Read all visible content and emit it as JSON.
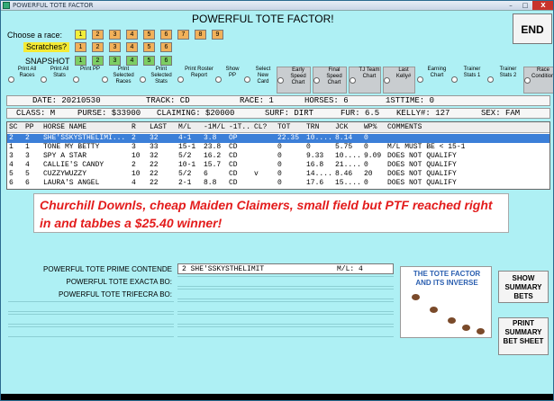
{
  "window": {
    "title": "POWERFUL TOTE FACTOR",
    "minimize": "–",
    "maximize": "□",
    "close": "X"
  },
  "app_title": "POWERFUL TOTE FACTOR!",
  "end_button": "END",
  "choose_race_label": "Choose  a race:",
  "scratches_label": "Scratches?",
  "snapshot_label": "SNAPSHOT",
  "race_buttons": [
    "1",
    "2",
    "3",
    "4",
    "5",
    "6",
    "7",
    "8",
    "9"
  ],
  "scratch_buttons": [
    "1",
    "2",
    "3",
    "4",
    "5",
    "6"
  ],
  "snapshot_buttons": [
    "1",
    "2",
    "3",
    "4",
    "5",
    "6"
  ],
  "options": [
    {
      "label": "Print All Races"
    },
    {
      "label": "Print All Stats"
    },
    {
      "label": "Print PP"
    },
    {
      "label": "Print Selected Races"
    },
    {
      "label": "Print Selected Stats"
    },
    {
      "label": "Print Roster Report"
    },
    {
      "label": "Show PP"
    },
    {
      "label": "Select New Card"
    },
    {
      "label": "Early Speed Chart"
    },
    {
      "label": "Final Speed Chart"
    },
    {
      "label": "TJ Team Chart"
    },
    {
      "label": "Last Kelly#"
    },
    {
      "label": "Earning Chart"
    },
    {
      "label": "Trainer Stats 1"
    },
    {
      "label": "Trainer Stats 2"
    },
    {
      "label": "Race Conditions"
    }
  ],
  "info1": {
    "date": "DATE: 20210530",
    "track": "TRACK: CD",
    "race": "RACE: 1",
    "horses": "HORSES: 6",
    "firsttime": "1STTIME:  0"
  },
  "info2": {
    "class": "CLASS: M",
    "purse": "PURSE: $33900",
    "claiming": "CLAIMING: $20000",
    "surf": "SURF: DIRT",
    "fur": "FUR: 6.5",
    "kelly": "KELLY#: 127",
    "sex": "SEX: FAM"
  },
  "columns": [
    "SC",
    "PP",
    "HORSE NAME",
    "R",
    "LAST",
    "M/L",
    "-1M/L",
    "-1T...",
    "CL?",
    "TOT",
    "TRN",
    "JCK",
    "WP%",
    "COMMENTS"
  ],
  "rows": [
    {
      "sc": "2",
      "pp": "2",
      "name": "SHE'SSKYSTHELIMI...",
      "r": "2",
      "last": "32",
      "ml": "4-1",
      "m1": "3.8",
      "t1": "OP",
      "cl": "",
      "tot": "22.35",
      "trn": "10....",
      "jck": "8.14",
      "wp": "0",
      "comments": "",
      "selected": true
    },
    {
      "sc": "1",
      "pp": "1",
      "name": "TONE MY BETTY",
      "r": "3",
      "last": "33",
      "ml": "15-1",
      "m1": "23.8",
      "t1": "CD",
      "cl": "",
      "tot": "0",
      "trn": "0",
      "jck": "5.75",
      "wp": "0",
      "comments": "M/L MUST BE < 15-1"
    },
    {
      "sc": "3",
      "pp": "3",
      "name": "SPY A STAR",
      "r": "10",
      "last": "32",
      "ml": "5/2",
      "m1": "16.2",
      "t1": "CD",
      "cl": "",
      "tot": "0",
      "trn": "9.33",
      "jck": "10....",
      "wp": "9.09",
      "comments": "DOES NOT QUALIFY"
    },
    {
      "sc": "4",
      "pp": "4",
      "name": "CALLIE'S CANDY",
      "r": "2",
      "last": "22",
      "ml": "10-1",
      "m1": "15.7",
      "t1": "CD",
      "cl": "",
      "tot": "0",
      "trn": "16.8",
      "jck": "21....",
      "wp": "0",
      "comments": "DOES NOT QUALIFY"
    },
    {
      "sc": "5",
      "pp": "5",
      "name": "CUZZYWUZZY",
      "r": "10",
      "last": "22",
      "ml": "5/2",
      "m1": "6",
      "t1": "CD",
      "cl": "v",
      "tot": "0",
      "trn": "14....",
      "jck": "8.46",
      "wp": "20",
      "comments": "DOES NOT QUALIFY"
    },
    {
      "sc": "6",
      "pp": "6",
      "name": "LAURA'S ANGEL",
      "r": "4",
      "last": "22",
      "ml": "2-1",
      "m1": "8.8",
      "t1": "CD",
      "cl": "",
      "tot": "0",
      "trn": "17.6",
      "jck": "15....",
      "wp": "0",
      "comments": "DOES NOT QUALIFY"
    }
  ],
  "note_text": "Churchill Downls, cheap Maiden Claimers, small field but PTF reached right in and tabbes a $25.40 winner!",
  "bottom": {
    "prime_label": "POWERFUL TOTE PRIME CONTENDE",
    "exacta_label": "POWERFUL TOTE EXACTA BO:",
    "trifecta_label": "POWERFUL TOTE TRIFECRA BO:",
    "prime_value": "2   SHE'SSKYSTHELIMIT",
    "prime_ml": "M/L: 4"
  },
  "logo_text": "THE TOTE FACTOR AND ITS INVERSE",
  "show_summary_button": "SHOW SUMMARY BETS",
  "print_summary_button": "PRINT SUMMARY BET SHEET",
  "colors": {
    "background": "#aef0f4",
    "selected_row": "#3c7fd8",
    "note_red": "#e31c1c"
  }
}
